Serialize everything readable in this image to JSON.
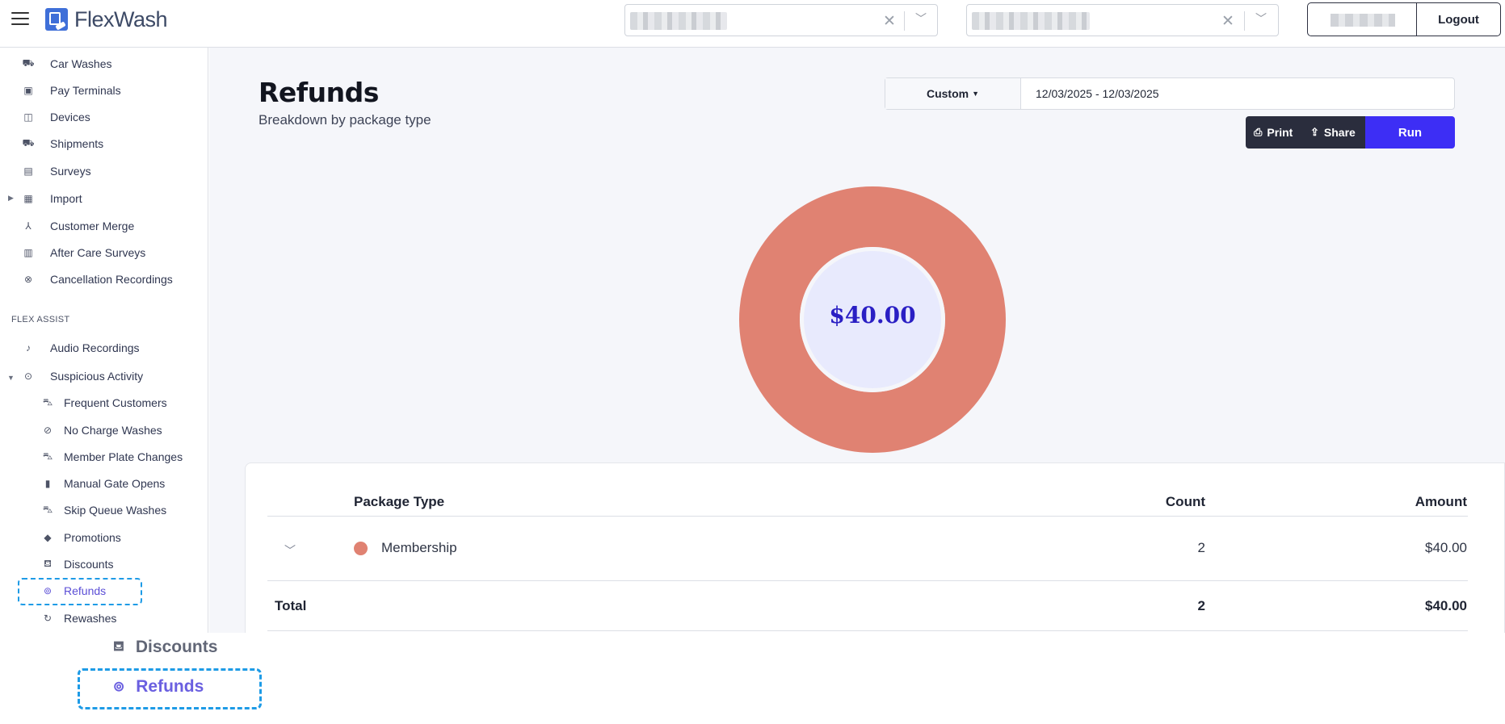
{
  "header": {
    "menu_icon": "hamburger-icon",
    "brand": "FlexWash",
    "logout_label": "Logout"
  },
  "sidebar": {
    "items": [
      {
        "label": "Car Washes",
        "icon": "car-wash-icon"
      },
      {
        "label": "Pay Terminals",
        "icon": "pay-terminal-icon"
      },
      {
        "label": "Devices",
        "icon": "devices-icon"
      },
      {
        "label": "Shipments",
        "icon": "truck-icon"
      },
      {
        "label": "Surveys",
        "icon": "clipboard-icon"
      },
      {
        "label": "Import",
        "icon": "file-import-icon"
      },
      {
        "label": "Customer Merge",
        "icon": "merge-icon"
      },
      {
        "label": "After Care Surveys",
        "icon": "clipboard-check-icon"
      },
      {
        "label": "Cancellation Recordings",
        "icon": "cancel-circle-icon"
      }
    ],
    "section_label": "FLEX ASSIST",
    "assist_items": [
      {
        "label": "Audio Recordings",
        "icon": "music-note-icon"
      },
      {
        "label": "Suspicious Activity",
        "icon": "alert-circle-icon"
      }
    ],
    "sub_items": [
      {
        "label": "Frequent Customers",
        "icon": "car-icon"
      },
      {
        "label": "No Charge Washes",
        "icon": "no-charge-icon"
      },
      {
        "label": "Member Plate Changes",
        "icon": "car-front-icon"
      },
      {
        "label": "Manual Gate Opens",
        "icon": "gate-icon"
      },
      {
        "label": "Skip Queue Washes",
        "icon": "skip-queue-icon"
      },
      {
        "label": "Promotions",
        "icon": "tag-icon"
      },
      {
        "label": "Discounts",
        "icon": "cart-discount-icon"
      },
      {
        "label": "Refunds",
        "icon": "refund-icon"
      },
      {
        "label": "Rewashes",
        "icon": "rewash-icon"
      }
    ]
  },
  "main": {
    "title": "Refunds",
    "subtitle": "Breakdown by package type",
    "range_preset": "Custom",
    "date_range": "12/03/2025 - 12/03/2025",
    "print_label": "Print",
    "share_label": "Share",
    "run_label": "Run",
    "donut_center": "$40.00"
  },
  "table": {
    "columns": [
      "Package Type",
      "Count",
      "Amount"
    ],
    "rows": [
      {
        "package": "Membership",
        "count": "2",
        "amount": "$40.00",
        "color": "#e08272"
      }
    ],
    "total_label": "Total",
    "total_count": "2",
    "total_amount": "$40.00"
  },
  "chart_data": {
    "type": "pie",
    "categories": [
      "Membership"
    ],
    "values": [
      40.0
    ],
    "colors": [
      "#e08272"
    ],
    "center_label": "$40.00"
  },
  "colors": {
    "accent": "#3d2ef5",
    "membership": "#e08272",
    "active_nav": "#5b4ed6",
    "highlight": "#1e9be6"
  },
  "zoom_inset": {
    "items": [
      {
        "label": "Discounts"
      },
      {
        "label": "Refunds"
      }
    ]
  }
}
